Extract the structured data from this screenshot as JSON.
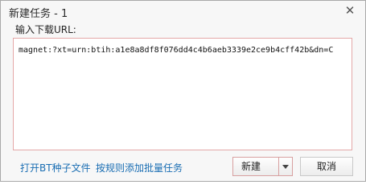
{
  "window": {
    "title": "新建任务 - 1",
    "close_glyph": "✕"
  },
  "form": {
    "url_label": "输入下载URL:",
    "url_value": "magnet:?xt=urn:btih:a1e8a8df8f076dd4c4b6aeb3339e2ce9b4cff42b&dn=C"
  },
  "links": {
    "open_bt": "打开BT种子文件",
    "batch_add": "按规则添加批量任务"
  },
  "buttons": {
    "new_label": "新建",
    "cancel_label": "取消"
  },
  "icons": {
    "close": "close-icon",
    "dropdown": "caret-down-icon"
  },
  "colors": {
    "link": "#1a6eb3",
    "field_border": "#e4a7a7"
  }
}
